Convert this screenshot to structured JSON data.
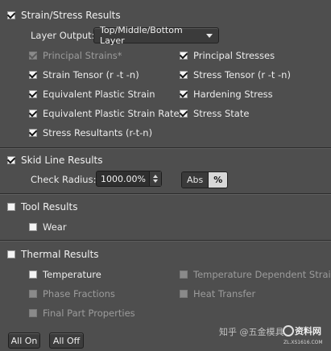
{
  "strain_stress": {
    "header": "Strain/Stress Results",
    "header_checked": true,
    "layer_output_label": "Layer Output:",
    "layer_output_value": "Top/Middle/Bottom Layer",
    "left_items": [
      {
        "label": "Principal Strains*",
        "checked": true,
        "disabled": true
      },
      {
        "label": "Strain Tensor (r -t -n)",
        "checked": true,
        "disabled": false
      },
      {
        "label": "Equivalent Plastic Strain",
        "checked": true,
        "disabled": false
      },
      {
        "label": "Equivalent Plastic Strain Rate",
        "checked": true,
        "disabled": false
      },
      {
        "label": "Stress Resultants (r-t-n)",
        "checked": true,
        "disabled": false
      }
    ],
    "right_items": [
      {
        "label": "Principal Stresses",
        "checked": true,
        "disabled": false
      },
      {
        "label": "Stress Tensor (r -t -n)",
        "checked": true,
        "disabled": false
      },
      {
        "label": "Hardening Stress",
        "checked": true,
        "disabled": false
      },
      {
        "label": "Stress State",
        "checked": true,
        "disabled": false
      }
    ]
  },
  "skid_line": {
    "header": "Skid Line Results",
    "header_checked": true,
    "check_radius_label": "Check Radius:",
    "check_radius_value": "1000.00%",
    "unit_abs": "Abs",
    "unit_pct": "%",
    "unit_selected": "%"
  },
  "tool": {
    "header": "Tool Results",
    "header_checked": false,
    "items": [
      {
        "label": "Wear",
        "checked": false,
        "disabled": false
      }
    ]
  },
  "thermal": {
    "header": "Thermal Results",
    "header_checked": false,
    "left_items": [
      {
        "label": "Temperature",
        "checked": false,
        "disabled": false
      },
      {
        "label": "Phase Fractions",
        "checked": false,
        "disabled": true
      },
      {
        "label": "Final Part Properties",
        "checked": false,
        "disabled": true
      }
    ],
    "right_items": [
      {
        "label": "Temperature Dependent Strains",
        "checked": false,
        "disabled": true
      },
      {
        "label": "Heat Transfer",
        "checked": false,
        "disabled": true
      }
    ]
  },
  "footer": {
    "all_on": "All On",
    "all_off": "All Off"
  },
  "watermark": {
    "text": "知乎 @五金模具",
    "logo_text": "资料网",
    "logo_sub": "ZL.XS1616.COM"
  }
}
